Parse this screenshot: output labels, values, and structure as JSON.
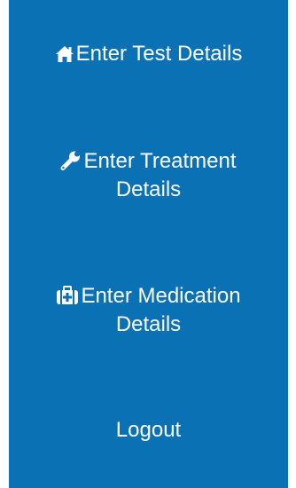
{
  "sidebar": {
    "background_color": "#0a71b4",
    "text_color": "#ffffff",
    "items": [
      {
        "label": "Enter Test Details",
        "icon": "home-icon"
      },
      {
        "label_line1": "Enter Treatment",
        "label_line2": "Details",
        "icon": "wrench-icon"
      },
      {
        "label_line1": "Enter Medication",
        "label_line2": "Details",
        "icon": "medkit-icon"
      },
      {
        "label": "Logout"
      }
    ]
  }
}
